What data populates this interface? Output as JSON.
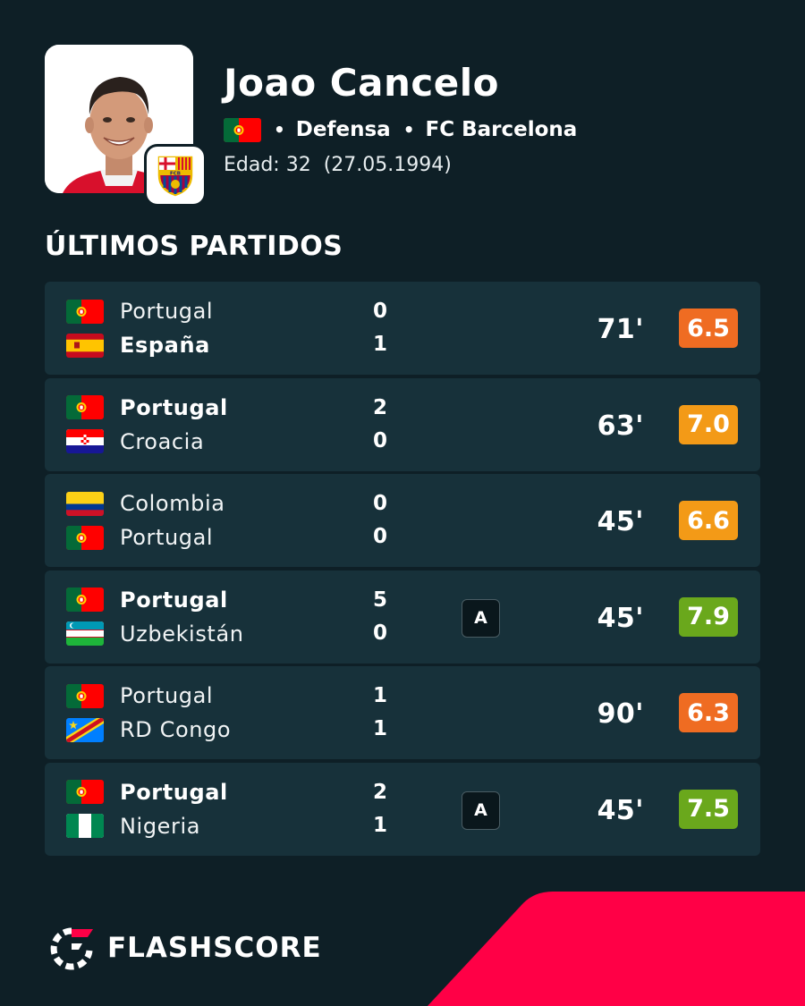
{
  "player": {
    "name": "Joao Cancelo",
    "flag": "portugal",
    "position": "Defensa",
    "club": "FC Barcelona",
    "age_label": "Edad: 32",
    "birthdate": "(27.05.1994)"
  },
  "section_title": "ÚLTIMOS PARTIDOS",
  "matches": [
    {
      "home": {
        "name": "Portugal",
        "flag": "portugal",
        "score": "0",
        "bold": false
      },
      "away": {
        "name": "España",
        "flag": "spain",
        "score": "1",
        "bold": true
      },
      "badge": "",
      "minutes": "71'",
      "rating": "6.5",
      "rating_color": "#ef6c22"
    },
    {
      "home": {
        "name": "Portugal",
        "flag": "portugal",
        "score": "2",
        "bold": true
      },
      "away": {
        "name": "Croacia",
        "flag": "croatia",
        "score": "0",
        "bold": false
      },
      "badge": "",
      "minutes": "63'",
      "rating": "7.0",
      "rating_color": "#f39a17"
    },
    {
      "home": {
        "name": "Colombia",
        "flag": "colombia",
        "score": "0",
        "bold": false
      },
      "away": {
        "name": "Portugal",
        "flag": "portugal",
        "score": "0",
        "bold": false
      },
      "badge": "",
      "minutes": "45'",
      "rating": "6.6",
      "rating_color": "#f39a17"
    },
    {
      "home": {
        "name": "Portugal",
        "flag": "portugal",
        "score": "5",
        "bold": true
      },
      "away": {
        "name": "Uzbekistán",
        "flag": "uzbekistan",
        "score": "0",
        "bold": false
      },
      "badge": "A",
      "minutes": "45'",
      "rating": "7.9",
      "rating_color": "#6aa81c"
    },
    {
      "home": {
        "name": "Portugal",
        "flag": "portugal",
        "score": "1",
        "bold": false
      },
      "away": {
        "name": "RD Congo",
        "flag": "drcongo",
        "score": "1",
        "bold": false
      },
      "badge": "",
      "minutes": "90'",
      "rating": "6.3",
      "rating_color": "#ef6c22"
    },
    {
      "home": {
        "name": "Portugal",
        "flag": "portugal",
        "score": "2",
        "bold": true
      },
      "away": {
        "name": "Nigeria",
        "flag": "nigeria",
        "score": "1",
        "bold": false
      },
      "badge": "A",
      "minutes": "45'",
      "rating": "7.5",
      "rating_color": "#6aa81c"
    }
  ],
  "brand": {
    "name": "FLASHSCORE",
    "accent": "#ff0046"
  }
}
